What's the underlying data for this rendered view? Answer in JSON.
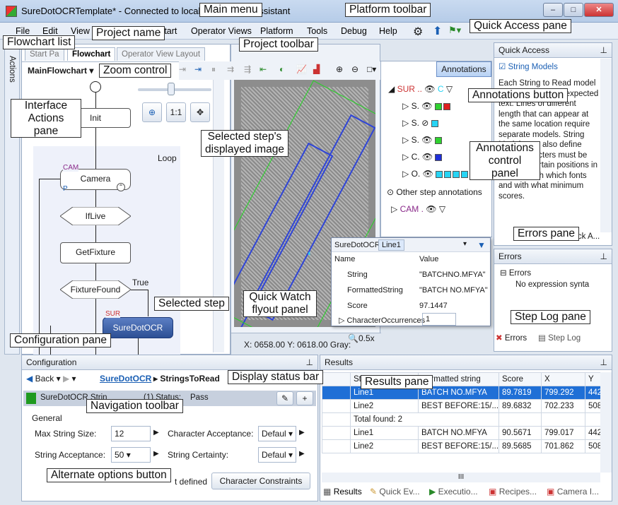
{
  "window": {
    "title": "SureDotOCRTemplate* - Connected to localhost - Vision Assistant",
    "controls": {
      "minimize": "–",
      "maximize": "□",
      "close": "✕"
    }
  },
  "menu": [
    "File",
    "Edit",
    "View",
    "Start",
    "Operator Views",
    "Platform",
    "Tools",
    "Debug",
    "Help"
  ],
  "flowchart": {
    "tabs": [
      "Start Pa",
      "Flowchart",
      "Operator View Layout"
    ],
    "selected_flowchart": "MainFlowchart",
    "sidebar_tab": "Actions",
    "zoom_button": "1:1",
    "loop_label": "Loop",
    "steps": {
      "init": "Init",
      "camera": "Camera",
      "camera_tag": "CAM",
      "camera_p": "P",
      "iflive": "IfLive",
      "getfixture": "GetFixture",
      "fixturefound": "FixtureFound",
      "true_label": "True",
      "sur_tag": "SUR",
      "suredotocr": "SureDotOCR"
    }
  },
  "image_view": {
    "status": "X: 0658.00 Y: 0618.00 Gray:",
    "zoom": "0.5x"
  },
  "annotations": {
    "button": "Annotations",
    "rows": [
      {
        "label": "SUR ..",
        "indent": 0
      },
      {
        "label": "S.",
        "indent": 1
      },
      {
        "label": "S.",
        "indent": 1
      },
      {
        "label": "S.",
        "indent": 1
      },
      {
        "label": "C.",
        "indent": 1
      },
      {
        "label": "O.",
        "indent": 1
      }
    ],
    "other": "Other step annotations",
    "cam_row": "CAM ."
  },
  "quick_access": {
    "title": "Quick Access",
    "link": "String Models",
    "body": "Each String to Read model has a set of ... the expected text. Lines of different length that can appear at the same location require separate models. String Models can also define what characters must be found at certain positions in the line, with which fonts and with what minimum scores.",
    "tab": "Quick A..."
  },
  "errors": {
    "title": "Errors",
    "root": "Errors",
    "item": "No expression synta",
    "tabs": [
      "Errors",
      "Step Log"
    ]
  },
  "quick_watch": {
    "tabs": [
      "SureDotOCR",
      "Line1"
    ],
    "headers": [
      "Name",
      "Value"
    ],
    "rows": [
      {
        "name": "String",
        "value": "\"BATCHNO.MFYA\""
      },
      {
        "name": "FormattedString",
        "value": "\"BATCH NO.MFYA\""
      },
      {
        "name": "Score",
        "value": "97.1447"
      },
      {
        "name": "CharacterOccurrences",
        "value": "1"
      }
    ]
  },
  "configuration": {
    "title": "Configuration",
    "back": "Back",
    "breadcrumb_step": "SureDotOCR",
    "breadcrumb_item": "StringsToRead",
    "step_name": "SureDotOCR Strin",
    "status_text": "(1) Status:",
    "status_value": "Pass",
    "group": "General",
    "fields": {
      "max_string_size_label": "Max String Size:",
      "max_string_size": "12",
      "string_acceptance_label": "String Acceptance:",
      "string_acceptance": "50",
      "char_acceptance_label": "Character Acceptance:",
      "char_acceptance": "Defaul",
      "string_certainty_label": "String Certainty:",
      "string_certainty": "Defaul"
    },
    "defined_text": "t defined",
    "char_constraints_button": "Character Constraints"
  },
  "results": {
    "title": "Results",
    "headers": [
      "St",
      "Formatted string",
      "Score",
      "X",
      "Y"
    ],
    "rows": [
      {
        "s": "Line1",
        "f": "BATCH NO.MFYA",
        "score": "89.7819",
        "x": "799.292",
        "y": "442.3",
        "selected": true
      },
      {
        "s": "Line2",
        "f": "BEST BEFORE:15/...",
        "score": "89.6832",
        "x": "702.233",
        "y": "508.8"
      },
      {
        "s": "Total found: 2",
        "f": "",
        "score": "",
        "x": "",
        "y": ""
      },
      {
        "s": "Line1",
        "f": "BATCH NO.MFYA",
        "score": "90.5671",
        "x": "799.017",
        "y": "442.4"
      },
      {
        "s": "Line2",
        "f": "BEST BEFORE:15/...",
        "score": "89.5685",
        "x": "701.862",
        "y": "508.8"
      }
    ],
    "scroll_label": "III",
    "tabs": [
      "Results",
      "Quick Ev...",
      "Executio...",
      "Recipes...",
      "Camera I..."
    ]
  },
  "callouts": {
    "project_name": "Project name",
    "main_menu": "Main menu",
    "platform_toolbar": "Platform toolbar",
    "quick_access_pane": "Quick Access pane",
    "flowchart_list": "Flowchart list",
    "project_toolbar": "Project toolbar",
    "zoom_control": "Zoom control",
    "annotations_button": "Annotations button",
    "interface_actions": "Interface Actions pane",
    "selected_image": "Selected step's displayed image",
    "annotations_panel": "Annotations control panel",
    "errors_pane": "Errors pane",
    "selected_step": "Selected step",
    "quick_watch": "Quick Watch flyout panel",
    "step_log": "Step Log pane",
    "configuration_pane": "Configuration pane",
    "display_status": "Display status bar",
    "results_pane": "Results pane",
    "navigation_toolbar": "Navigation toolbar",
    "alternate_options": "Alternate options button"
  }
}
